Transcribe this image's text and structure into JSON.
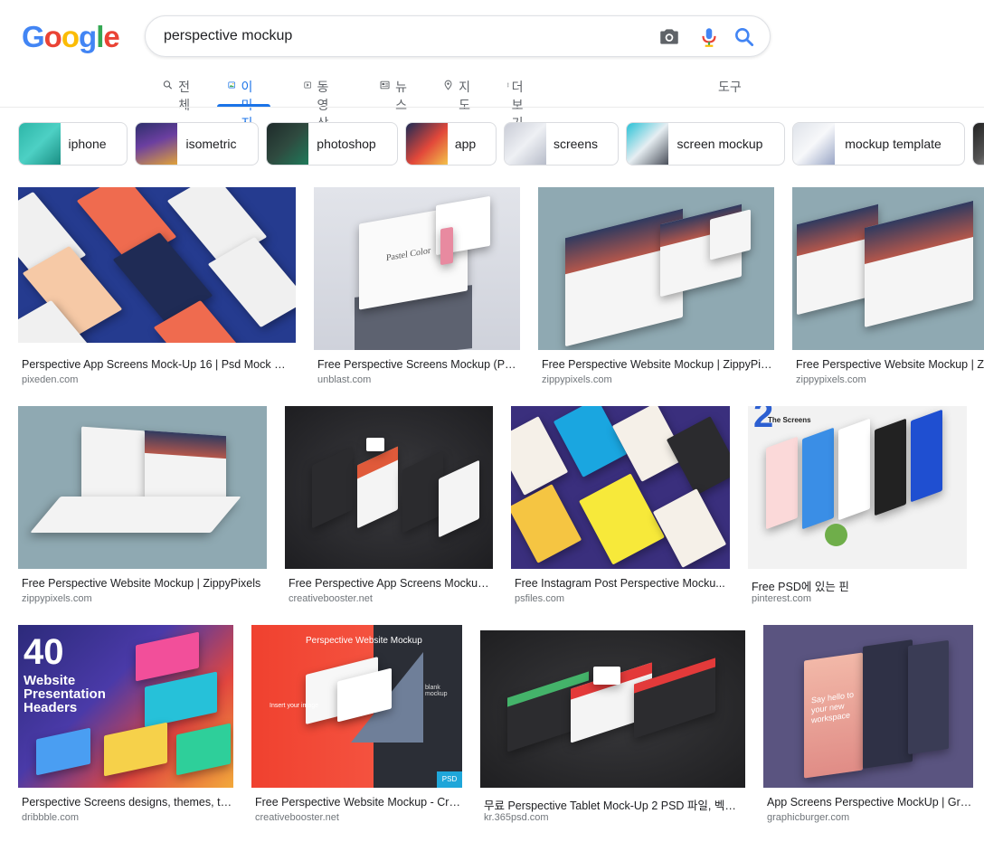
{
  "logo": {
    "text": "Google"
  },
  "search": {
    "query": "perspective mockup"
  },
  "tabs": [
    {
      "label": "전체",
      "icon": "search-icon"
    },
    {
      "label": "이미지",
      "icon": "image-icon"
    },
    {
      "label": "동영상",
      "icon": "video-icon"
    },
    {
      "label": "뉴스",
      "icon": "news-icon"
    },
    {
      "label": "지도",
      "icon": "map-pin-icon"
    },
    {
      "label": "더보기",
      "icon": "more-vertical-icon"
    }
  ],
  "tools_label": "도구",
  "chips": [
    "iphone",
    "isometric",
    "photoshop",
    "app",
    "screens",
    "screen mockup",
    "mockup template"
  ],
  "results": [
    {
      "title": "Perspective App Screens Mock-Up 16 | Psd Mock Up...",
      "domain": "pixeden.com"
    },
    {
      "title": "Free Perspective Screens Mockup (PS...",
      "domain": "unblast.com"
    },
    {
      "title": "Free Perspective Website Mockup | ZippyPix...",
      "domain": "zippypixels.com"
    },
    {
      "title": "Free Perspective Website Mockup | ZippyPix",
      "domain": "zippypixels.com"
    },
    {
      "title": "Free Perspective Website Mockup | ZippyPixels",
      "domain": "zippypixels.com"
    },
    {
      "title": "Free Perspective App Screens Mockup...",
      "domain": "creativebooster.net"
    },
    {
      "title": "Free Instagram Post Perspective Mocku...",
      "domain": "psfiles.com"
    },
    {
      "title": "Free PSD에 있는 핀",
      "domain": "pinterest.com"
    },
    {
      "title": "Perspective Screens designs, themes, te...",
      "domain": "dribbble.com"
    },
    {
      "title": "Free Perspective Website Mockup - Cre...",
      "domain": "creativebooster.net"
    },
    {
      "title": "무료 Perspective Tablet Mock-Up 2 PSD 파일, 벡터...",
      "domain": "kr.365psd.com"
    },
    {
      "title": "App Screens Perspective MockUp | Gra...",
      "domain": "graphicburger.com"
    }
  ],
  "image_text": {
    "r9_number": "40",
    "r9_headline": "Website Presentation Headers",
    "r10_title": "Perspective Website Mockup",
    "r10_note1": "Insert your image",
    "r10_note2": "blank mockup",
    "r10_badge": "PSD",
    "r8_brand": "The Screens",
    "r8_number": "2",
    "r12_text": "Say hello to your new workspace",
    "r2_text": "Pastel Color"
  },
  "colors": {
    "accent": "#1a73e8",
    "logo_blue": "#4285F4",
    "logo_red": "#EA4335",
    "logo_yellow": "#FBBC05",
    "logo_green": "#34A853"
  }
}
